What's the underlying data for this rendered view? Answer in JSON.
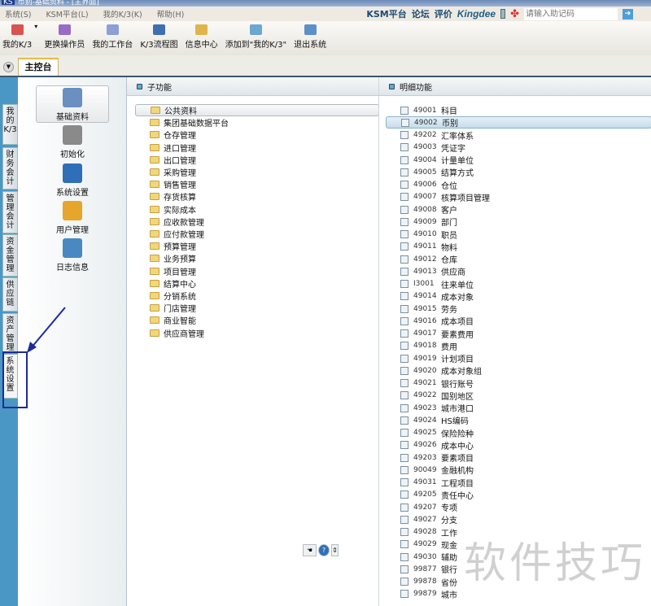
{
  "window": {
    "title": "币别-基础资料 - [主界面]",
    "logo": "KS"
  },
  "menu": [
    "系统(S)",
    "KSM平台(L)",
    "我的K/3(K)",
    "帮助(H)"
  ],
  "top_links": {
    "ksm": "KSM平台",
    "forum": "论坛",
    "rating": "评价",
    "brand": "Kingdee",
    "helper_placeholder": "请输入助记码"
  },
  "toolbar": [
    {
      "label": "我的K/3",
      "icon": "star-icon",
      "color": "#d9534f"
    },
    {
      "label": "更换操作员",
      "icon": "users-icon",
      "color": "#9a6bc4"
    },
    {
      "label": "我的工作台",
      "icon": "workbench-icon",
      "color": "#8c9fd6"
    },
    {
      "label": "K/3流程图",
      "icon": "flowchart-icon",
      "color": "#3f6fae"
    },
    {
      "label": "信息中心",
      "icon": "message-icon",
      "color": "#e0b44c"
    },
    {
      "label": "添加到\"我的K/3\"",
      "icon": "add-favorite-icon",
      "color": "#6ba7d0"
    },
    {
      "label": "退出系统",
      "icon": "exit-icon",
      "color": "#5d8fc8"
    }
  ],
  "tabs": {
    "main": "主控台"
  },
  "vertical_tabs": [
    "我的K/3",
    "财务会计",
    "管理会计",
    "资金管理",
    "供应链",
    "资产管理",
    "系统设置"
  ],
  "nav": [
    {
      "label": "基础资料",
      "selected": true,
      "color": "#6a8fc0"
    },
    {
      "label": "初始化",
      "color": "#8a8a8a"
    },
    {
      "label": "系统设置",
      "color": "#2f6fb7"
    },
    {
      "label": "用户管理",
      "color": "#e6a52b"
    },
    {
      "label": "日志信息",
      "color": "#4a88c2"
    }
  ],
  "sub_panel": {
    "title": "子功能",
    "items": [
      "公共资料",
      "集团基础数据平台",
      "仓存管理",
      "进口管理",
      "出口管理",
      "采购管理",
      "销售管理",
      "存货核算",
      "实际成本",
      "应收款管理",
      "应付款管理",
      "预算管理",
      "业务预算",
      "项目管理",
      "结算中心",
      "分销系统",
      "门店管理",
      "商业智能",
      "供应商管理"
    ]
  },
  "detail_panel": {
    "title": "明细功能",
    "selected_index": 1,
    "items": [
      [
        "49001",
        "科目"
      ],
      [
        "49002",
        "币别"
      ],
      [
        "49202",
        "汇率体系"
      ],
      [
        "49003",
        "凭证字"
      ],
      [
        "49004",
        "计量单位"
      ],
      [
        "49005",
        "结算方式"
      ],
      [
        "49006",
        "仓位"
      ],
      [
        "49007",
        "核算项目管理"
      ],
      [
        "49008",
        "客户"
      ],
      [
        "49009",
        "部门"
      ],
      [
        "49010",
        "职员"
      ],
      [
        "49011",
        "物料"
      ],
      [
        "49012",
        "仓库"
      ],
      [
        "49013",
        "供应商"
      ],
      [
        "I3001",
        "往来单位"
      ],
      [
        "49014",
        "成本对象"
      ],
      [
        "49015",
        "劳务"
      ],
      [
        "49016",
        "成本项目"
      ],
      [
        "49017",
        "要素费用"
      ],
      [
        "49018",
        "费用"
      ],
      [
        "49019",
        "计划项目"
      ],
      [
        "49020",
        "成本对象组"
      ],
      [
        "49021",
        "银行账号"
      ],
      [
        "49022",
        "国别地区"
      ],
      [
        "49023",
        "城市港口"
      ],
      [
        "49024",
        "HS编码"
      ],
      [
        "49025",
        "保险险种"
      ],
      [
        "49026",
        "成本中心"
      ],
      [
        "49203",
        "要素项目"
      ],
      [
        "90049",
        "金融机构"
      ],
      [
        "49031",
        "工程项目"
      ],
      [
        "49205",
        "责任中心"
      ],
      [
        "49207",
        "专项"
      ],
      [
        "49027",
        "分支"
      ],
      [
        "49028",
        "工作"
      ],
      [
        "49029",
        "现金"
      ],
      [
        "49030",
        "辅助"
      ],
      [
        "99877",
        "银行"
      ],
      [
        "99878",
        "省份"
      ],
      [
        "99879",
        "城市"
      ]
    ]
  },
  "watermark": "软件技巧"
}
